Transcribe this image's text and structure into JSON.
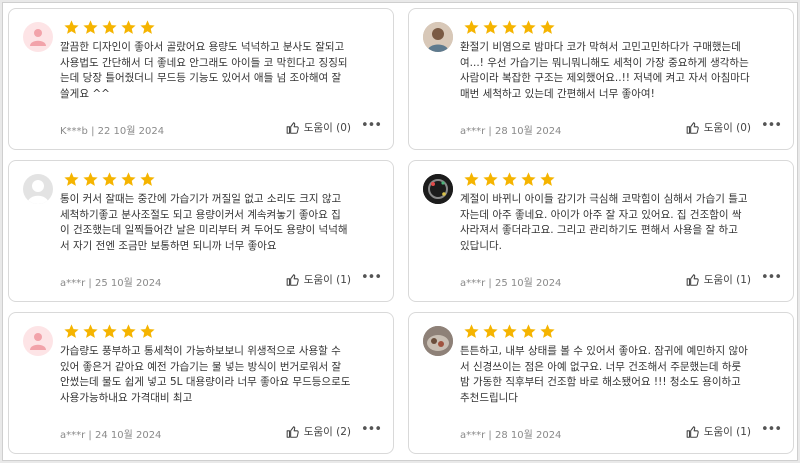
{
  "colors": {
    "star": "#f5b400",
    "border": "#d9d9d9",
    "meta": "#8a8a8a"
  },
  "reviews": [
    {
      "avatar": "pink-default-avatar",
      "rating": 5,
      "text": "깔끔한 디자인이 좋아서 골랐어요 용량도 넉넉하고 분사도 잘되고\n사용법도 간단해서 더 좋네요 안그래도 아이들 코 막힌다고 징징되\n는데 당장 틀어줬더니 무드등 기능도 있어서 애들 넘 조아해여 잘\n쓸게요 ^^",
      "author_date": "K***b | 22 10월 2024",
      "helpful_label": "도움이 (0)"
    },
    {
      "avatar": "photo-avatar",
      "rating": 5,
      "text": "환절기 비염으로 밤마다 코가 막혀서 고민고민하다가 구매했는데\n여...! 우선 가습기는 뭐니뭐니해도 세척이 가장 중요하게 생각하는\n사람이라 복잡한 구조는 제외했어요..!! 저녁에 켜고 자서 아침마다\n매번 세척하고 있는데 간편해서 너무 좋아여!",
      "author_date": "a***r | 28 10월 2024",
      "helpful_label": "도움이 (0)"
    },
    {
      "avatar": "gray-default-avatar",
      "rating": 5,
      "text": "통이 커서 잘때는 중간에 가습기가 꺼질일 없고 소리도 크지 않고\n세척하기좋고 분사조절도 되고 용량이커서 계속켜놓기 좋아요 집\n이 건조했는데 일찍들어간 날은 미리부터 켜 두어도 용량이 넉넉해\n서 자기 전엔 조금만 보통하면 되니까 너무 좋아요",
      "author_date": "a***r | 25 10월 2024",
      "helpful_label": "도움이 (1)"
    },
    {
      "avatar": "dark-photo-avatar",
      "rating": 5,
      "text": "계절이 바뀌니 아이들 감기가 극심해 코막힘이 심해서 가습기 틀고\n자는데 아주 좋네요. 아이가 아주 잘 자고 있어요. 집 건조함이 싹\n사라져서 좋더라고요. 그리고 관리하기도 편해서 사용을 잘 하고\n있답니다.",
      "author_date": "a***r | 25 10월 2024",
      "helpful_label": "도움이 (1)"
    },
    {
      "avatar": "pink-default-avatar",
      "rating": 5,
      "text": "가습량도 풍부하고 통세척이 가능하보보니 위생적으로 사용할 수\n있어 좋은거 같아요 예전 가습기는 물 넣는 방식이 번거로워서 잘\n안썼는데 물도 쉽게 넣고 5L 대용량이라 너무 좋아요 무드등으로도\n사용가능하내요 가격대비 최고",
      "author_date": "a***r | 24 10월 2024",
      "helpful_label": "도움이 (2)"
    },
    {
      "avatar": "food-photo-avatar",
      "rating": 5,
      "text": "튼튼하고, 내부 상태를 볼 수 있어서 좋아요. 잠귀에 예민하지 않아\n서 신경쓰이는 점은 아예 없구요. 너무 건조해서 주문했는데 하룻\n밤 가동한 직후부터 건조함 바로 해소됐어요 !!! 청소도 용이하고\n추천드립니다",
      "author_date": "a***r | 28 10월 2024",
      "helpful_label": "도움이 (1)"
    }
  ]
}
